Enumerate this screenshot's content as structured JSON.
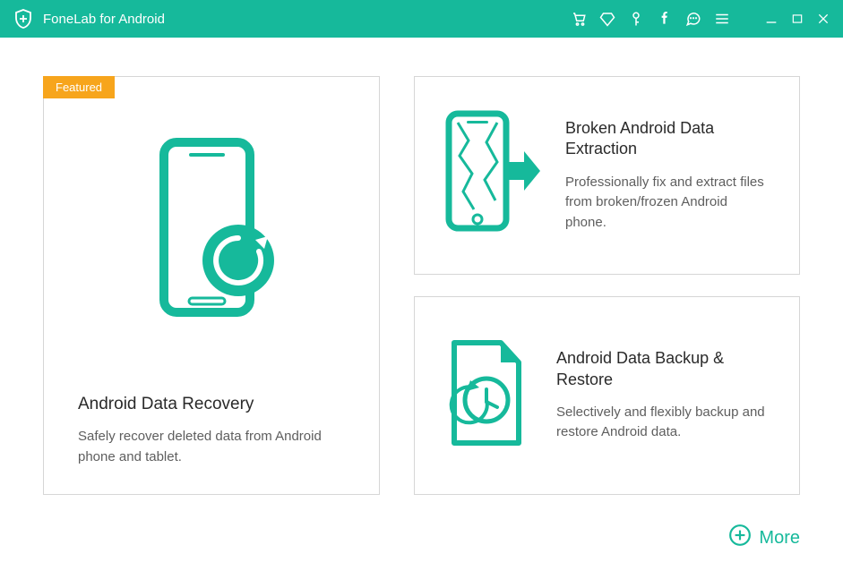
{
  "colors": {
    "accent": "#16b99b",
    "badge": "#f7a51c"
  },
  "titlebar": {
    "app_title": "FoneLab for Android"
  },
  "badge_label": "Featured",
  "cards": {
    "recovery": {
      "title": "Android Data Recovery",
      "desc": "Safely recover deleted data from Android phone and tablet."
    },
    "broken": {
      "title": "Broken Android Data Extraction",
      "desc": "Professionally fix and extract files from broken/frozen Android phone."
    },
    "backup": {
      "title": "Android Data Backup & Restore",
      "desc": "Selectively and flexibly backup and restore Android data."
    }
  },
  "more_label": "More"
}
